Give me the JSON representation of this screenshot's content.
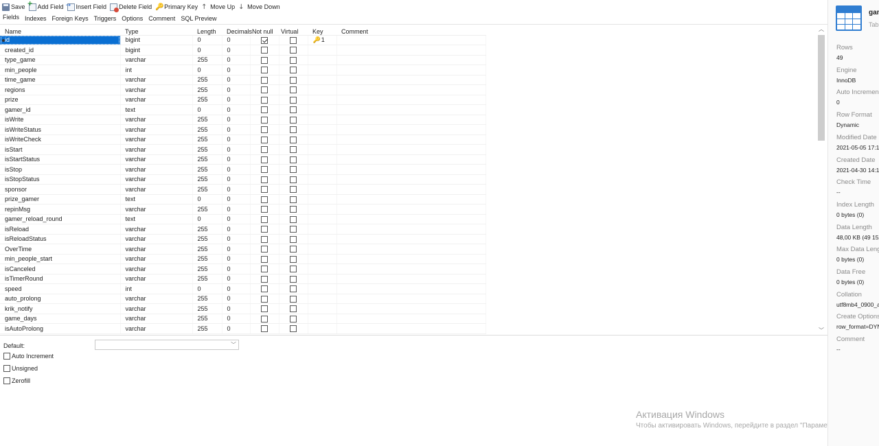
{
  "toolbar": {
    "save": "Save",
    "add_field": "Add Field",
    "insert_field": "Insert Field",
    "delete_field": "Delete Field",
    "primary_key": "Primary Key",
    "move_up": "Move Up",
    "move_down": "Move Down"
  },
  "tabs": [
    "Fields",
    "Indexes",
    "Foreign Keys",
    "Triggers",
    "Options",
    "Comment",
    "SQL Preview"
  ],
  "active_tab": "Fields",
  "columns": {
    "name": "Name",
    "type": "Type",
    "length": "Length",
    "decimals": "Decimals",
    "not_null": "Not null",
    "virtual": "Virtual",
    "key": "Key",
    "comment": "Comment"
  },
  "fields": [
    {
      "name": "id",
      "type": "bigint",
      "length": "0",
      "decimals": "0",
      "not_null": true,
      "virtual": false,
      "key": "1",
      "selected": true
    },
    {
      "name": "created_id",
      "type": "bigint",
      "length": "0",
      "decimals": "0",
      "not_null": false,
      "virtual": false,
      "key": ""
    },
    {
      "name": "type_game",
      "type": "varchar",
      "length": "255",
      "decimals": "0",
      "not_null": false,
      "virtual": false,
      "key": ""
    },
    {
      "name": "min_people",
      "type": "int",
      "length": "0",
      "decimals": "0",
      "not_null": false,
      "virtual": false,
      "key": ""
    },
    {
      "name": "time_game",
      "type": "varchar",
      "length": "255",
      "decimals": "0",
      "not_null": false,
      "virtual": false,
      "key": ""
    },
    {
      "name": "regions",
      "type": "varchar",
      "length": "255",
      "decimals": "0",
      "not_null": false,
      "virtual": false,
      "key": ""
    },
    {
      "name": "prize",
      "type": "varchar",
      "length": "255",
      "decimals": "0",
      "not_null": false,
      "virtual": false,
      "key": ""
    },
    {
      "name": "gamer_id",
      "type": "text",
      "length": "0",
      "decimals": "0",
      "not_null": false,
      "virtual": false,
      "key": ""
    },
    {
      "name": "isWrite",
      "type": "varchar",
      "length": "255",
      "decimals": "0",
      "not_null": false,
      "virtual": false,
      "key": ""
    },
    {
      "name": "isWriteStatus",
      "type": "varchar",
      "length": "255",
      "decimals": "0",
      "not_null": false,
      "virtual": false,
      "key": ""
    },
    {
      "name": "isWriteCheck",
      "type": "varchar",
      "length": "255",
      "decimals": "0",
      "not_null": false,
      "virtual": false,
      "key": ""
    },
    {
      "name": "isStart",
      "type": "varchar",
      "length": "255",
      "decimals": "0",
      "not_null": false,
      "virtual": false,
      "key": ""
    },
    {
      "name": "isStartStatus",
      "type": "varchar",
      "length": "255",
      "decimals": "0",
      "not_null": false,
      "virtual": false,
      "key": ""
    },
    {
      "name": "isStop",
      "type": "varchar",
      "length": "255",
      "decimals": "0",
      "not_null": false,
      "virtual": false,
      "key": ""
    },
    {
      "name": "isStopStatus",
      "type": "varchar",
      "length": "255",
      "decimals": "0",
      "not_null": false,
      "virtual": false,
      "key": ""
    },
    {
      "name": "sponsor",
      "type": "varchar",
      "length": "255",
      "decimals": "0",
      "not_null": false,
      "virtual": false,
      "key": ""
    },
    {
      "name": "prize_gamer",
      "type": "text",
      "length": "0",
      "decimals": "0",
      "not_null": false,
      "virtual": false,
      "key": ""
    },
    {
      "name": "repinMsg",
      "type": "varchar",
      "length": "255",
      "decimals": "0",
      "not_null": false,
      "virtual": false,
      "key": ""
    },
    {
      "name": "gamer_reload_round",
      "type": "text",
      "length": "0",
      "decimals": "0",
      "not_null": false,
      "virtual": false,
      "key": ""
    },
    {
      "name": "isReload",
      "type": "varchar",
      "length": "255",
      "decimals": "0",
      "not_null": false,
      "virtual": false,
      "key": ""
    },
    {
      "name": "isReloadStatus",
      "type": "varchar",
      "length": "255",
      "decimals": "0",
      "not_null": false,
      "virtual": false,
      "key": ""
    },
    {
      "name": "OverTime",
      "type": "varchar",
      "length": "255",
      "decimals": "0",
      "not_null": false,
      "virtual": false,
      "key": ""
    },
    {
      "name": "min_people_start",
      "type": "varchar",
      "length": "255",
      "decimals": "0",
      "not_null": false,
      "virtual": false,
      "key": ""
    },
    {
      "name": "isCanceled",
      "type": "varchar",
      "length": "255",
      "decimals": "0",
      "not_null": false,
      "virtual": false,
      "key": ""
    },
    {
      "name": "isTimerRound",
      "type": "varchar",
      "length": "255",
      "decimals": "0",
      "not_null": false,
      "virtual": false,
      "key": ""
    },
    {
      "name": "speed",
      "type": "int",
      "length": "0",
      "decimals": "0",
      "not_null": false,
      "virtual": false,
      "key": ""
    },
    {
      "name": "auto_prolong",
      "type": "varchar",
      "length": "255",
      "decimals": "0",
      "not_null": false,
      "virtual": false,
      "key": ""
    },
    {
      "name": "krik_notify",
      "type": "varchar",
      "length": "255",
      "decimals": "0",
      "not_null": false,
      "virtual": false,
      "key": ""
    },
    {
      "name": "game_days",
      "type": "varchar",
      "length": "255",
      "decimals": "0",
      "not_null": false,
      "virtual": false,
      "key": ""
    },
    {
      "name": "isAutoProlong",
      "type": "varchar",
      "length": "255",
      "decimals": "0",
      "not_null": false,
      "virtual": false,
      "key": ""
    }
  ],
  "field_props": {
    "default_label": "Default:",
    "default_value": "",
    "auto_increment": "Auto Increment",
    "unsigned": "Unsigned",
    "zerofill": "Zerofill"
  },
  "watermark": {
    "title": "Активация Windows",
    "subtitle": "Чтобы активировать Windows, перейдите в раздел \"Параметры\"."
  },
  "info": {
    "name": "gam",
    "subtitle": "Tabl",
    "items": [
      {
        "label": "Rows",
        "value": "49"
      },
      {
        "label": "Engine",
        "value": "InnoDB"
      },
      {
        "label": "Auto Incremen",
        "value": "0"
      },
      {
        "label": "Row Format",
        "value": "Dynamic"
      },
      {
        "label": "Modified Date",
        "value": "2021-05-05 17:1"
      },
      {
        "label": "Created Date",
        "value": "2021-04-30 14:1"
      },
      {
        "label": "Check Time",
        "value": "--"
      },
      {
        "label": "Index Length",
        "value": "0 bytes (0)"
      },
      {
        "label": "Data Length",
        "value": "48,00 KB (49 152"
      },
      {
        "label": "Max Data Leng",
        "value": "0 bytes (0)"
      },
      {
        "label": "Data Free",
        "value": "0 bytes (0)"
      },
      {
        "label": "Collation",
        "value": "utf8mb4_0900_a"
      },
      {
        "label": "Create Options",
        "value": "row_format=DYN"
      },
      {
        "label": "Comment",
        "value": "--"
      }
    ]
  },
  "colors": {
    "selection": "#0a6fd2",
    "accent": "#2f7dd1",
    "key": "#d49a1c"
  },
  "icons": {
    "save": "save-icon",
    "add": "add-field-icon",
    "insert": "insert-field-icon",
    "delete": "delete-field-icon",
    "key": "key-icon",
    "up": "arrow-up-icon",
    "down": "arrow-down-icon",
    "table": "table-icon"
  }
}
